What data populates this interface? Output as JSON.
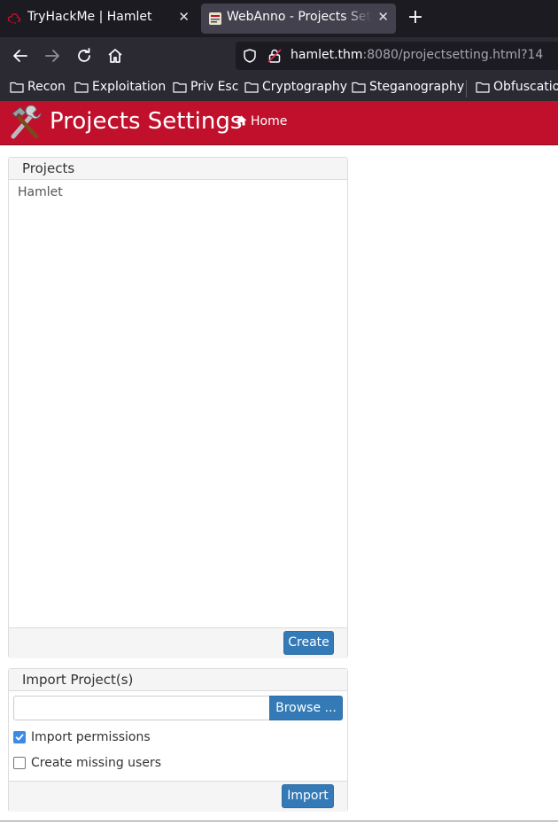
{
  "browser": {
    "tabs": [
      {
        "title": "TryHackMe | Hamlet",
        "active": false
      },
      {
        "title": "WebAnno - Projects Settings",
        "active": true
      }
    ],
    "url": {
      "host": "hamlet.thm",
      "rest": ":8080/projectsetting.html?14"
    },
    "bookmarks": [
      "Recon",
      "Exploitation",
      "Priv Esc",
      "Cryptography",
      "Steganography",
      "Obfuscation"
    ]
  },
  "header": {
    "title": "Projects Settings",
    "home_label": "Home",
    "color": "#c1102b"
  },
  "projects": {
    "heading": "Projects",
    "items": [
      "Hamlet"
    ],
    "create_label": "Create"
  },
  "import": {
    "heading": "Import Project(s)",
    "browse_label": "Browse ...",
    "import_permissions": {
      "label": "Import permissions",
      "checked": true
    },
    "create_missing_users": {
      "label": "Create missing users",
      "checked": false
    },
    "import_label": "Import"
  },
  "colors": {
    "accent_button": "#337ab7",
    "checkbox_checked": "#3d8ae6"
  }
}
